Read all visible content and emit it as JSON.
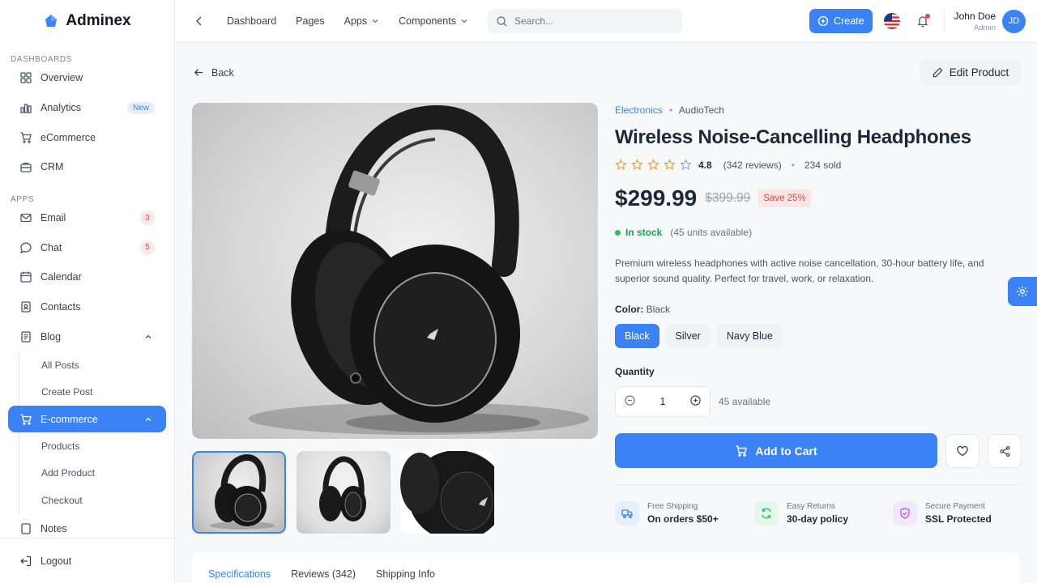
{
  "brand": {
    "name": "Adminex"
  },
  "sidebar": {
    "sections": {
      "dashboards": "DASHBOARDS",
      "apps": "APPS"
    },
    "items": {
      "overview": "Overview",
      "analytics": "Analytics",
      "analytics_badge": "New",
      "ecommerce": "eCommerce",
      "crm": "CRM",
      "email": "Email",
      "email_badge": "3",
      "chat": "Chat",
      "chat_badge": "5",
      "calendar": "Calendar",
      "contacts": "Contacts",
      "blog": "Blog",
      "all_posts": "All Posts",
      "create_post": "Create Post",
      "ecommerce_app": "E-commerce",
      "products": "Products",
      "add_product": "Add Product",
      "checkout": "Checkout",
      "notes": "Notes"
    },
    "logout": "Logout"
  },
  "topbar": {
    "nav": [
      "Dashboard",
      "Pages",
      "Apps",
      "Components"
    ],
    "search_placeholder": "Search...",
    "create": "Create",
    "user_name": "John Doe",
    "user_role": "Admin",
    "avatar_initials": "JD"
  },
  "page": {
    "back": "Back",
    "edit": "Edit Product"
  },
  "product": {
    "category": "Electronics",
    "brand": "AudioTech",
    "title": "Wireless Noise-Cancelling Headphones",
    "rating": 4.8,
    "rating_text": "4.8",
    "reviews": "(342 reviews)",
    "sold": "234 sold",
    "price": "$299.99",
    "old_price": "$399.99",
    "save": "Save 25%",
    "stock_status": "In stock",
    "stock_units": "(45 units available)",
    "description": "Premium wireless headphones with active noise cancellation, 30-hour battery life, and superior sound quality. Perfect for travel, work, or relaxation.",
    "color_label": "Color:",
    "color_value": "Black",
    "colors": [
      "Black",
      "Silver",
      "Navy Blue"
    ],
    "quantity_label": "Quantity",
    "quantity": "1",
    "quantity_available": "45 available",
    "add_to_cart": "Add to Cart"
  },
  "features": [
    {
      "title": "Free Shipping",
      "text": "On orders $50+"
    },
    {
      "title": "Easy Returns",
      "text": "30-day policy"
    },
    {
      "title": "Secure Payment",
      "text": "SSL Protected"
    }
  ],
  "tabs": [
    "Specifications",
    "Reviews (342)",
    "Shipping Info"
  ],
  "colors": {
    "accent": "#3b82f6",
    "success": "#22c55e",
    "danger": "#ef4444",
    "star": "#f59e0b"
  }
}
